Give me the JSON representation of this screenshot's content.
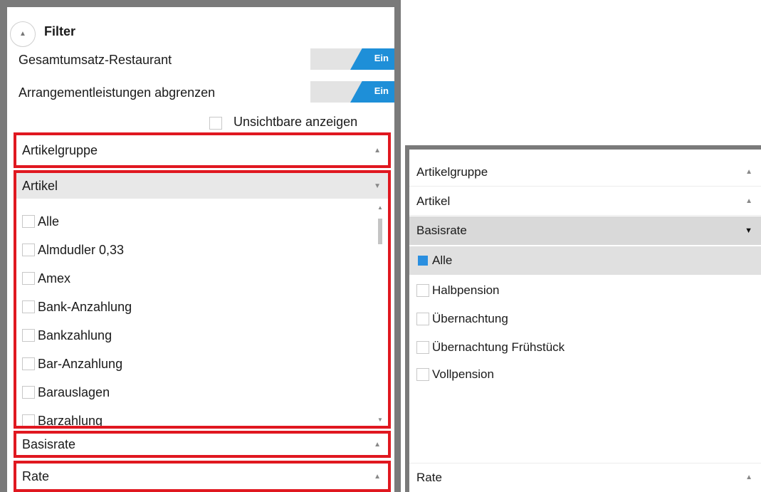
{
  "filter": {
    "title": "Filter",
    "toggles": [
      {
        "label": "Gesamtumsatz-Restaurant",
        "state": "Ein"
      },
      {
        "label": "Arrangementleistungen abgrenzen",
        "state": "Ein"
      }
    ],
    "show_hidden_label": "Unsichtbare anzeigen"
  },
  "left_sections": {
    "artikelgruppe": "Artikelgruppe",
    "artikel": "Artikel",
    "basisrate": "Basisrate",
    "rate": "Rate"
  },
  "artikel_items": [
    "Alle",
    "Almdudler 0,33",
    "Amex",
    "Bank-Anzahlung",
    "Bankzahlung",
    "Bar-Anzahlung",
    "Barauslagen",
    "Barzahlung"
  ],
  "right_sections": {
    "artikelgruppe": "Artikelgruppe",
    "artikel": "Artikel",
    "basisrate": "Basisrate",
    "rate": "Rate"
  },
  "basisrate_items": [
    "Alle",
    "Halbpension",
    "Übernachtung",
    "Übernachtung Frühstück",
    "Vollpension"
  ],
  "colors": {
    "accent": "#1e8fd8",
    "highlight": "#e01820",
    "panel_border": "#7a7a7a"
  },
  "icons": {
    "collapse": "chevron-up-icon",
    "expand": "chevron-down-icon"
  }
}
